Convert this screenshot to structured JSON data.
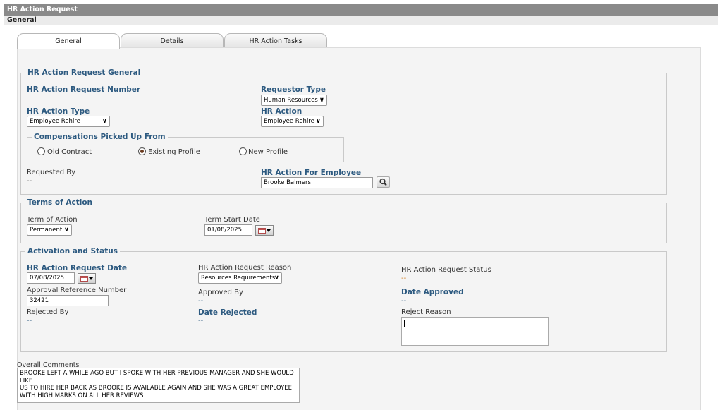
{
  "window": {
    "title": "HR Action Request",
    "section": "General"
  },
  "tabs": [
    {
      "label": "General",
      "active": true
    },
    {
      "label": "Details",
      "active": false
    },
    {
      "label": "HR Action Tasks",
      "active": false
    }
  ],
  "general": {
    "legend": "HR Action Request General",
    "request_number_label": "HR Action Request Number",
    "requestor_type_label": "Requestor Type",
    "requestor_type_value": "Human Resources",
    "action_type_label": "HR Action Type",
    "action_type_value": "Employee Rehire",
    "action_label": "HR Action",
    "action_value": "Employee Rehire",
    "compensations": {
      "legend": "Compensations Picked Up From",
      "options": [
        {
          "label": "Old Contract",
          "checked": false
        },
        {
          "label": "Existing Profile",
          "checked": true
        },
        {
          "label": "New Profile",
          "checked": false
        }
      ]
    },
    "requested_by_label": "Requested By",
    "requested_by_value": "--",
    "for_employee_label": "HR Action For Employee",
    "for_employee_value": "Brooke Balmers"
  },
  "terms": {
    "legend": "Terms of Action",
    "term_label": "Term of Action",
    "term_value": "Permanent",
    "start_date_label": "Term Start Date",
    "start_date_value": "01/08/2025"
  },
  "activation": {
    "legend": "Activation and Status",
    "request_date_label": "HR Action Request Date",
    "request_date_value": "07/08/2025",
    "reason_label": "HR Action Request Reason",
    "reason_value": "Resources Requirements",
    "status_label": "HR Action Request Status",
    "status_value": "--",
    "approval_ref_label": "Approval Reference Number",
    "approval_ref_value": "32421",
    "approved_by_label": "Approved By",
    "approved_by_value": "--",
    "date_approved_label": "Date Approved",
    "date_approved_value": "--",
    "rejected_by_label": "Rejected By",
    "rejected_by_value": "--",
    "date_rejected_label": "Date Rejected",
    "date_rejected_value": "--",
    "reject_reason_label": "Reject Reason",
    "reject_reason_value": ""
  },
  "comments": {
    "label": "Overall Comments",
    "lines": [
      "BROOKE LEFT A WHILE AGO BUT I SPOKE WITH HER PREVIOUS MANAGER AND SHE WOULD LIKE",
      "US TO HIRE HER BACK AS BROOKE IS AVAILABLE AGAIN AND SHE WAS A GREAT EMPLOYEE",
      "WITH HIGH MARKS ON ALL HER REVIEWS"
    ]
  }
}
